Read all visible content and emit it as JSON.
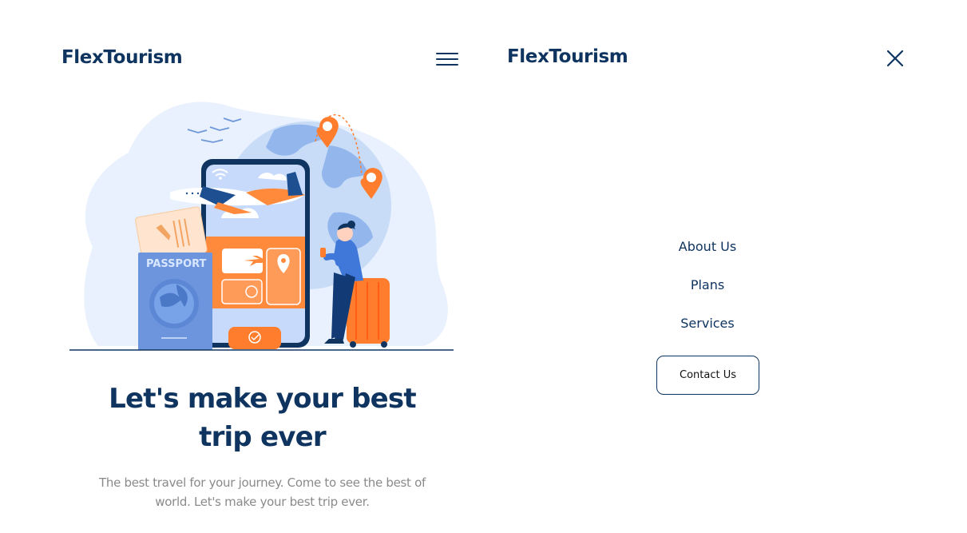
{
  "left_panel": {
    "brand": "FlexTourism",
    "menu_icon": "hamburger-menu-icon",
    "hero": {
      "title": "Let's make your best trip ever",
      "description": "The best travel for your journey. Come to see the best of world. Let's make your best trip ever.",
      "illustration": {
        "passport_label": "PASSPORT"
      }
    }
  },
  "right_panel": {
    "brand": "FlexTourism",
    "close_icon": "close-icon",
    "nav": [
      {
        "label": "About Us"
      },
      {
        "label": "Plans"
      },
      {
        "label": "Services"
      }
    ],
    "contact_label": "Contact Us"
  },
  "colors": {
    "brand_navy": "#0f3460",
    "accent_orange": "#ff7d2d",
    "soft_blue": "#dce9fb",
    "body_gray": "#8a8a8a"
  }
}
